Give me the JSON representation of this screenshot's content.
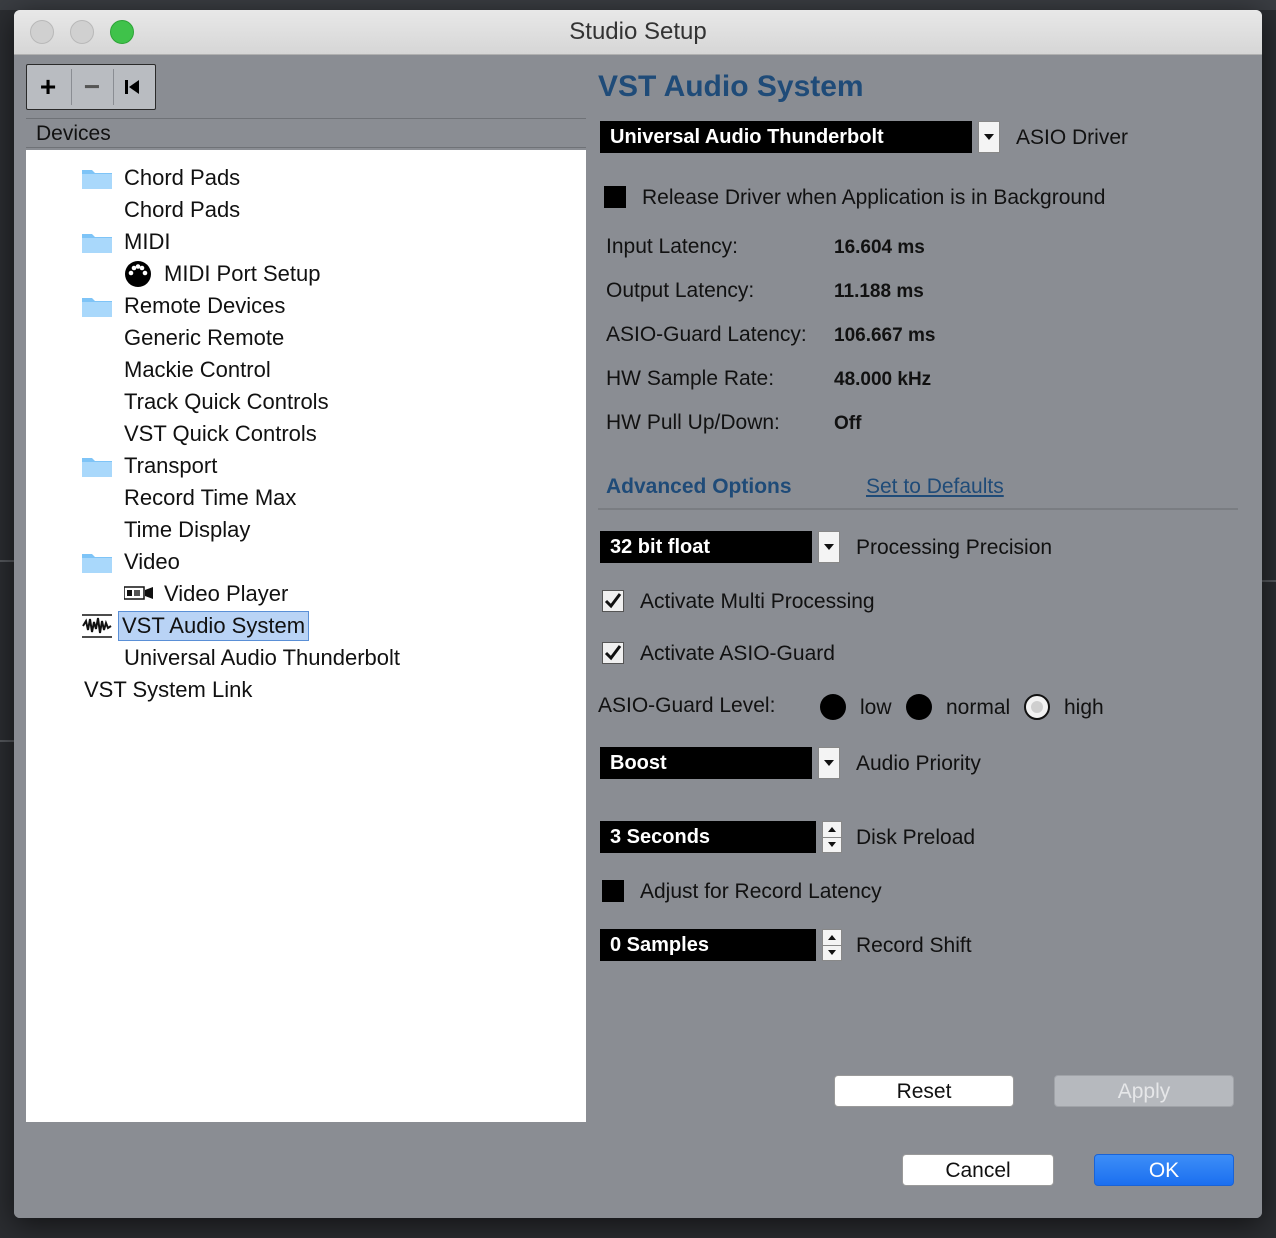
{
  "window": {
    "title": "Studio Setup"
  },
  "toolbar": {
    "add_label": "+",
    "remove_label": "−"
  },
  "devices": {
    "header": "Devices",
    "items": [
      {
        "label": "Chord Pads",
        "icon": "folder-icon"
      },
      {
        "label": "Chord Pads"
      },
      {
        "label": "MIDI",
        "icon": "folder-icon"
      },
      {
        "label": "MIDI Port Setup",
        "icon": "midi-port-icon"
      },
      {
        "label": "Remote Devices",
        "icon": "folder-icon"
      },
      {
        "label": "Generic Remote"
      },
      {
        "label": "Mackie Control"
      },
      {
        "label": "Track Quick Controls"
      },
      {
        "label": "VST Quick Controls"
      },
      {
        "label": "Transport",
        "icon": "folder-icon"
      },
      {
        "label": "Record Time Max"
      },
      {
        "label": "Time Display"
      },
      {
        "label": "Video",
        "icon": "folder-icon"
      },
      {
        "label": "Video Player",
        "icon": "video-player-icon"
      },
      {
        "label": "VST Audio System",
        "icon": "audio-waveform-icon",
        "selected": true
      },
      {
        "label": "Universal Audio Thunderbolt"
      },
      {
        "label": "VST System Link"
      }
    ]
  },
  "vst": {
    "title": "VST Audio System",
    "driver_value": "Universal Audio Thunderbolt",
    "driver_label": "ASIO Driver",
    "release_driver_label": "Release Driver when Application is in Background",
    "release_driver_checked": false,
    "latency": {
      "input_label": "Input Latency:",
      "input_value": "16.604 ms",
      "output_label": "Output Latency:",
      "output_value": "11.188 ms",
      "guard_label": "ASIO-Guard Latency:",
      "guard_value": "106.667 ms",
      "rate_label": "HW Sample Rate:",
      "rate_value": "48.000 kHz",
      "pull_label": "HW Pull Up/Down:",
      "pull_value": "Off"
    },
    "advanced_label": "Advanced Options",
    "defaults_link": "Set to Defaults",
    "precision_value": "32 bit float",
    "precision_label": "Processing Precision",
    "multi_processing_label": "Activate Multi Processing",
    "multi_processing_checked": true,
    "asio_guard_label": "Activate ASIO-Guard",
    "asio_guard_checked": true,
    "guard_level_label": "ASIO-Guard Level:",
    "guard_level_options": [
      "low",
      "normal",
      "high"
    ],
    "guard_level_selected": "high",
    "priority_value": "Boost",
    "priority_label": "Audio Priority",
    "preload_value": "3 Seconds",
    "preload_label": "Disk Preload",
    "record_latency_label": "Adjust for Record Latency",
    "record_latency_checked": false,
    "record_shift_value": "0 Samples",
    "record_shift_label": "Record Shift",
    "reset_label": "Reset",
    "apply_label": "Apply"
  },
  "footer": {
    "cancel_label": "Cancel",
    "ok_label": "OK"
  },
  "colors": {
    "accent": "#1f4b78",
    "ok_button": "#1b6ff0",
    "panel_bg": "#8a8d93"
  }
}
